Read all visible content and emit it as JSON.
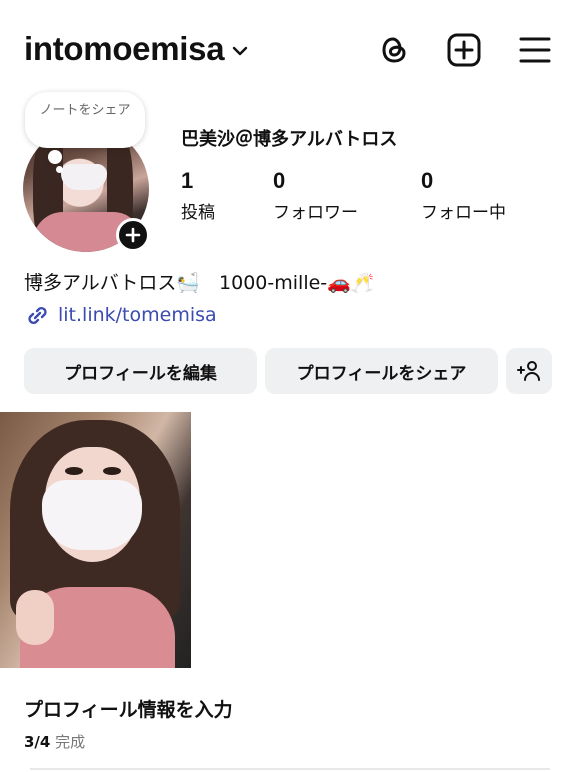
{
  "header": {
    "username": "intomoemisa",
    "icons": [
      "chevron-down-icon",
      "threads-icon",
      "create-icon",
      "menu-icon"
    ]
  },
  "profile": {
    "note_text": "ノートをシェア",
    "display_name": "巴美沙＠博多アルバトロス",
    "stats": [
      {
        "value": "1",
        "label": "投稿"
      },
      {
        "value": "0",
        "label": "フォロワー"
      },
      {
        "value": "0",
        "label": "フォロー中"
      }
    ],
    "bio": "博多アルバトロス🛀　1000-mille-🚗🥂",
    "link": "lit.link/tomemisa"
  },
  "buttons": {
    "edit_profile": "プロフィールを編集",
    "share_profile": "プロフィールをシェア"
  },
  "onboarding": {
    "title": "プロフィール情報を入力",
    "progress_count": "3/4",
    "progress_label": "完成"
  },
  "colors": {
    "link": "#3b4bb0",
    "button_bg": "#eff0f2"
  }
}
